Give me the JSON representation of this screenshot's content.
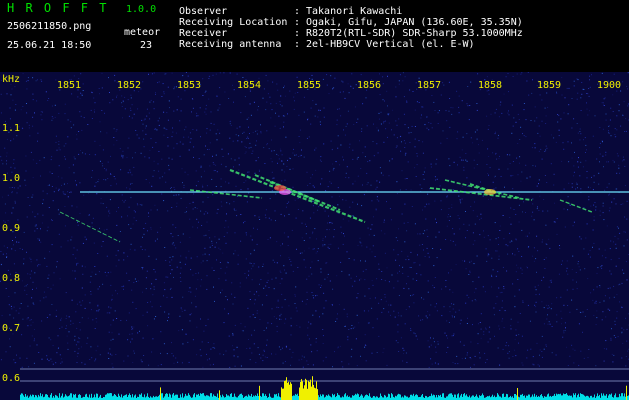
{
  "header": {
    "app_title": "H R O F F T",
    "version": "1.0.0",
    "filename": "2506211850.png",
    "datetime": "25.06.21 18:50",
    "meteor_label": "meteor",
    "meteor_count": "23",
    "info": [
      {
        "key": "Observer",
        "sep": ":",
        "value": "Takanori Kawachi"
      },
      {
        "key": "Receiving Location",
        "sep": ":",
        "value": "Ogaki, Gifu, JAPAN (136.60E, 35.35N)"
      },
      {
        "key": "Receiver",
        "sep": ":",
        "value": "R820T2(RTL-SDR) SDR-Sharp 53.1000MHz"
      },
      {
        "key": "Receiving antenna",
        "sep": ":",
        "value": "2el-HB9CV Vertical (el. E-W)"
      }
    ]
  },
  "spectrogram": {
    "y_unit": "kHz",
    "x_ticks": [
      "1851",
      "1852",
      "1853",
      "1854",
      "1855",
      "1856",
      "1857",
      "1858",
      "1859",
      "1900"
    ],
    "y_ticks": [
      "1.1",
      "1.0",
      "0.9",
      "0.8",
      "0.7",
      "0.6"
    ],
    "colors": {
      "background": "#08083a",
      "carrier": "#6fe3ff",
      "meteor": "#40e070",
      "labels": "#f0f000",
      "activity": "#00dfe8",
      "activity_peak": "#f0f000"
    }
  }
}
